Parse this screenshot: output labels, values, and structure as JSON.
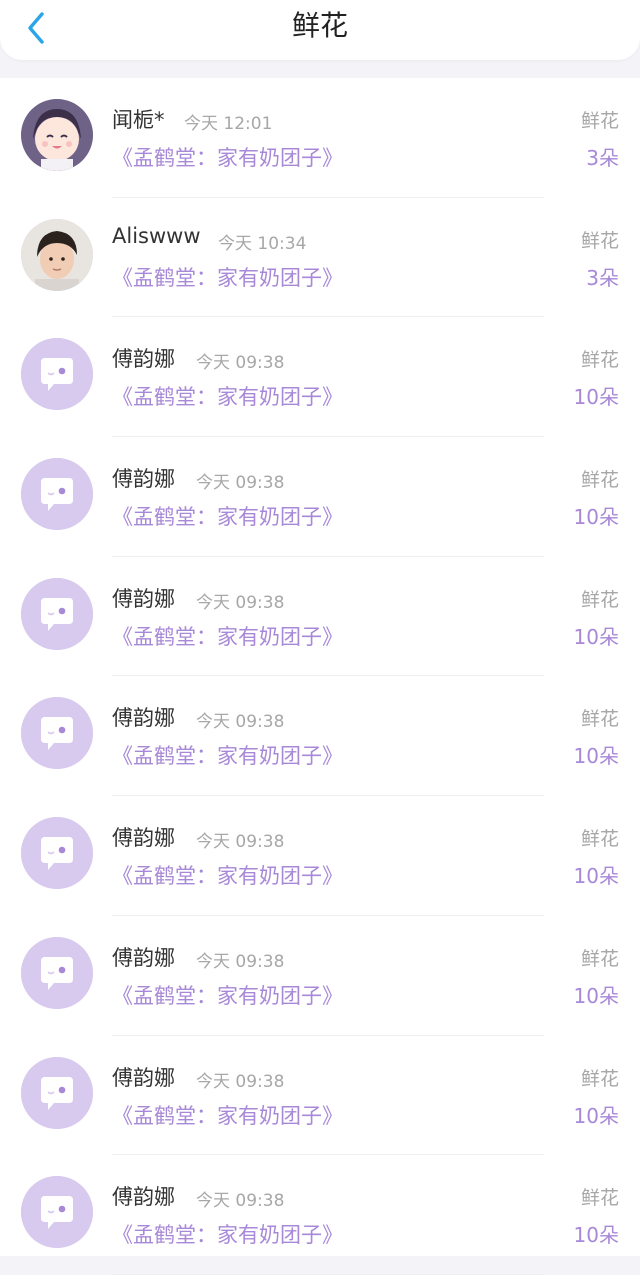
{
  "header": {
    "title": "鲜花"
  },
  "icons": {
    "back": "chevron-left-icon",
    "default_avatar": "chat-bubble-avatar-icon"
  },
  "colors": {
    "accent": "#a888d8",
    "back_arrow": "#2aa6e8",
    "avatar_bg": "#d8c9ef"
  },
  "list": [
    {
      "name": "闻栀*",
      "time": "今天 12:01",
      "book": "《孟鹤堂：家有奶团子》",
      "kind": "鲜花",
      "count": "3朵",
      "avatar": "anime"
    },
    {
      "name": "Aliswww",
      "time": "今天 10:34",
      "book": "《孟鹤堂：家有奶团子》",
      "kind": "鲜花",
      "count": "3朵",
      "avatar": "photo"
    },
    {
      "name": "傅韵娜",
      "time": "今天 09:38",
      "book": "《孟鹤堂：家有奶团子》",
      "kind": "鲜花",
      "count": "10朵",
      "avatar": "default"
    },
    {
      "name": "傅韵娜",
      "time": "今天 09:38",
      "book": "《孟鹤堂：家有奶团子》",
      "kind": "鲜花",
      "count": "10朵",
      "avatar": "default"
    },
    {
      "name": "傅韵娜",
      "time": "今天 09:38",
      "book": "《孟鹤堂：家有奶团子》",
      "kind": "鲜花",
      "count": "10朵",
      "avatar": "default"
    },
    {
      "name": "傅韵娜",
      "time": "今天 09:38",
      "book": "《孟鹤堂：家有奶团子》",
      "kind": "鲜花",
      "count": "10朵",
      "avatar": "default"
    },
    {
      "name": "傅韵娜",
      "time": "今天 09:38",
      "book": "《孟鹤堂：家有奶团子》",
      "kind": "鲜花",
      "count": "10朵",
      "avatar": "default"
    },
    {
      "name": "傅韵娜",
      "time": "今天 09:38",
      "book": "《孟鹤堂：家有奶团子》",
      "kind": "鲜花",
      "count": "10朵",
      "avatar": "default"
    },
    {
      "name": "傅韵娜",
      "time": "今天 09:38",
      "book": "《孟鹤堂：家有奶团子》",
      "kind": "鲜花",
      "count": "10朵",
      "avatar": "default"
    },
    {
      "name": "傅韵娜",
      "time": "今天 09:38",
      "book": "《孟鹤堂：家有奶团子》",
      "kind": "鲜花",
      "count": "10朵",
      "avatar": "default"
    }
  ]
}
